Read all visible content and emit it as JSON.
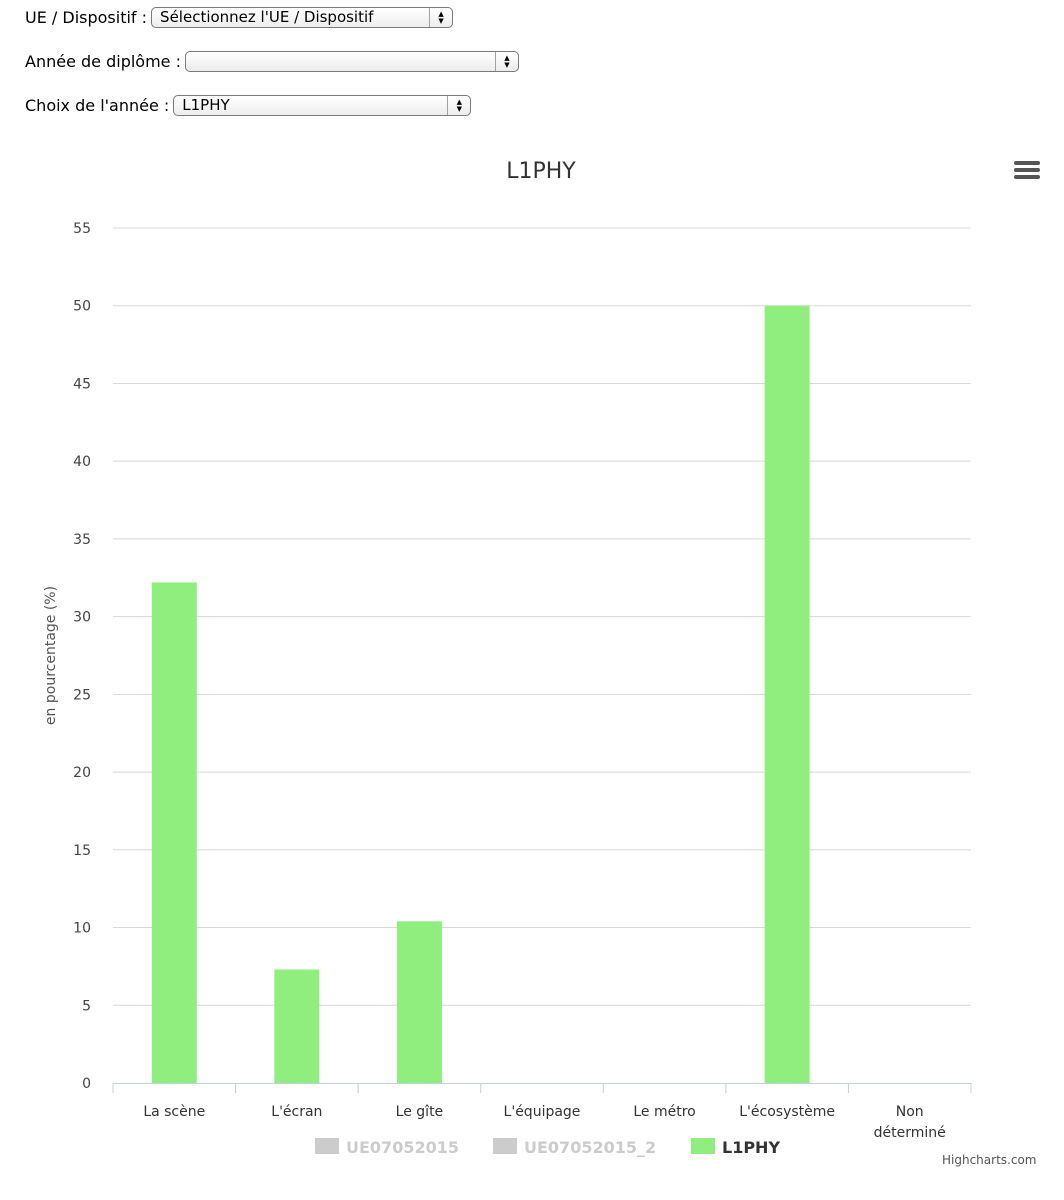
{
  "form": {
    "ue_label": "UE / Dispositif :",
    "ue_value": "Sélectionnez l'UE / Dispositif",
    "annee_label": "Année de diplôme :",
    "annee_value": "",
    "choix_label": "Choix de l'année :",
    "choix_value": "L1PHY"
  },
  "credits": "Highcharts.com",
  "menu_icon": "hamburger-menu-icon",
  "colors": {
    "bar": "#90ee7e",
    "legend_inactive": "#cccccc",
    "grid": "#d8d8d8",
    "axis": "#c0d0e0"
  },
  "chart_data": {
    "type": "bar",
    "title": "L1PHY",
    "ylabel": "en pourcentage (%)",
    "xlabel": "",
    "ylim": [
      0,
      55
    ],
    "yticks": [
      0,
      5,
      10,
      15,
      20,
      25,
      30,
      35,
      40,
      45,
      50,
      55
    ],
    "categories": [
      "La scène",
      "L'écran",
      "Le gîte",
      "L'équipage",
      "Le métro",
      "L'écosystème",
      "Non déterminé"
    ],
    "category_lines": [
      [
        "La scène"
      ],
      [
        "L'écran"
      ],
      [
        "Le gîte"
      ],
      [
        "L'équipage"
      ],
      [
        "Le métro"
      ],
      [
        "L'écosystème"
      ],
      [
        "Non",
        "déterminé"
      ]
    ],
    "series": [
      {
        "name": "UE07052015",
        "visible": false,
        "values": []
      },
      {
        "name": "UE07052015_2",
        "visible": false,
        "values": []
      },
      {
        "name": "L1PHY",
        "visible": true,
        "color": "#90ee7e",
        "values": [
          32.2,
          7.3,
          10.4,
          0,
          0,
          50,
          0
        ]
      }
    ],
    "grid": true,
    "legend": "bottom-center"
  }
}
